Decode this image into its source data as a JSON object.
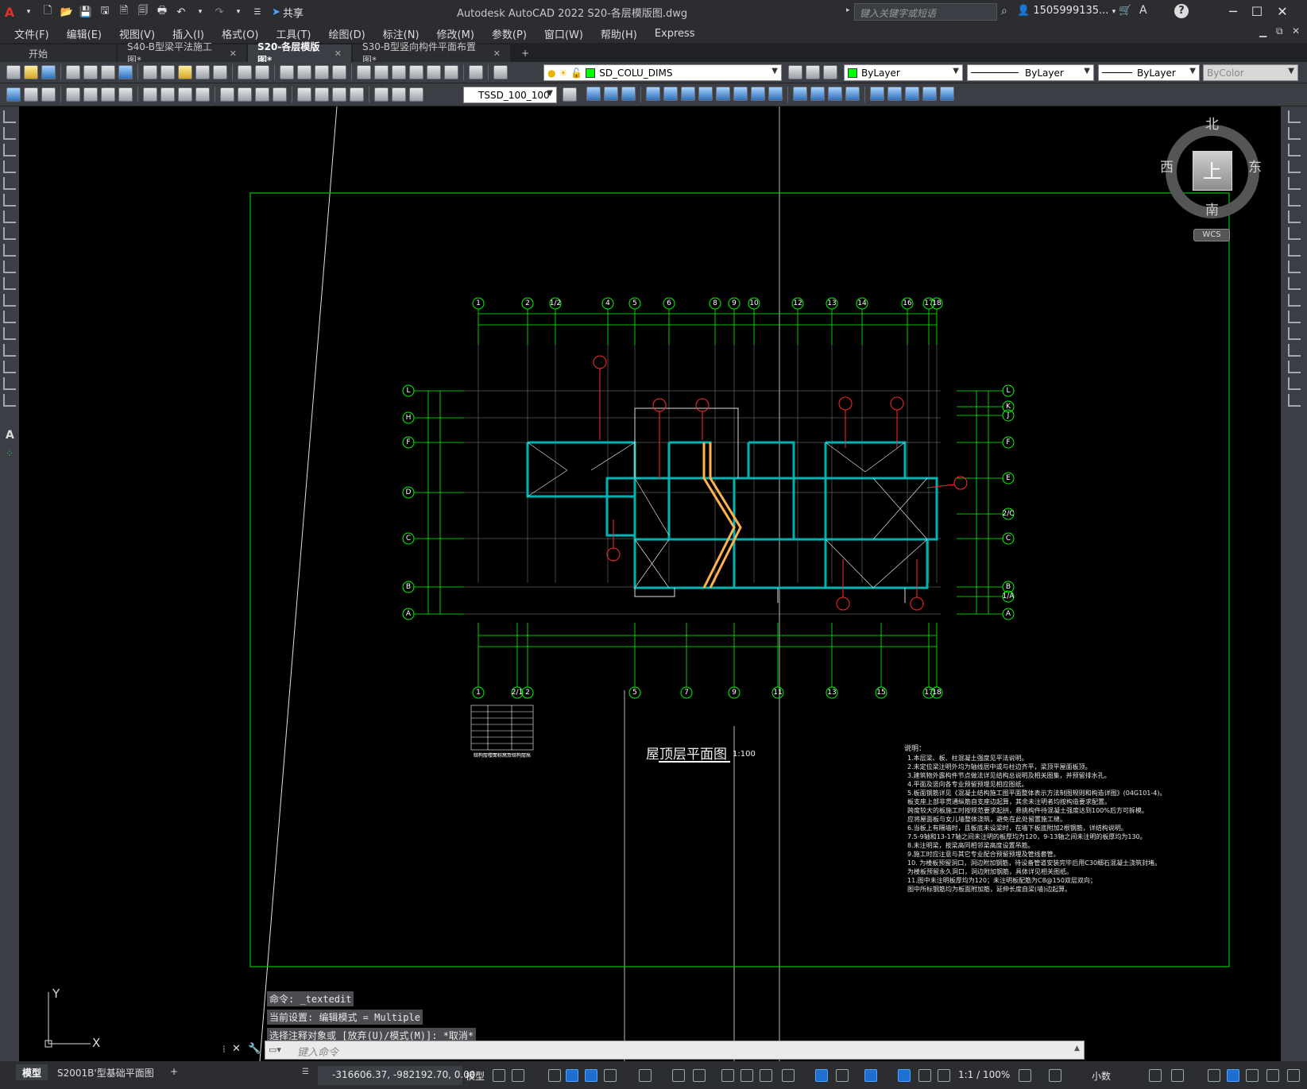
{
  "app": {
    "title": "Autodesk AutoCAD 2022    S20-各层模版图.dwg",
    "search_placeholder": "键入关键字或短语",
    "user": "1505999135...",
    "share_label": "共享"
  },
  "menu": [
    "文件(F)",
    "编辑(E)",
    "视图(V)",
    "插入(I)",
    "格式(O)",
    "工具(T)",
    "绘图(D)",
    "标注(N)",
    "修改(M)",
    "参数(P)",
    "窗口(W)",
    "帮助(H)",
    "Express"
  ],
  "tabs": [
    {
      "label": "开始",
      "active": false,
      "closable": false
    },
    {
      "label": "S40-B型梁平法施工图*",
      "active": false,
      "closable": true
    },
    {
      "label": "S20-各层模版图*",
      "active": true,
      "closable": true
    },
    {
      "label": "S30-B型竖向构件平面布置图*",
      "active": false,
      "closable": true
    }
  ],
  "toolbar": {
    "layer": "SD_COLU_DIMS",
    "color": "ByLayer",
    "linetype": "ByLayer",
    "lineweight": "ByLayer",
    "plotstyle": "ByColor",
    "annoscale": "TSSD_100_100"
  },
  "colors": {
    "grid_green": "#00ff00",
    "wall_cyan": "#00b3b3",
    "tag_red": "#ff2a2a",
    "beam_orange": "#ffb050",
    "border_green": "#00c800"
  },
  "compass": {
    "north": "北",
    "south": "南",
    "east": "东",
    "west": "西",
    "top": "上",
    "wcs": "WCS"
  },
  "drawing": {
    "top_axes": [
      "1",
      "2",
      "1/2",
      "4",
      "5",
      "6",
      "8",
      "9",
      "10",
      "12",
      "13",
      "14",
      "16",
      "17",
      "18"
    ],
    "bottom_axes": [
      "1",
      "2/1",
      "2",
      "5",
      "7",
      "9",
      "11",
      "13",
      "15",
      "17",
      "18"
    ],
    "left_axes": [
      "L",
      "H",
      "F",
      "D",
      "C",
      "B",
      "A"
    ],
    "right_axes": [
      "L",
      "K",
      "J",
      "F",
      "E",
      "2/C",
      "C",
      "B",
      "1/A",
      "A"
    ],
    "plan_title": "屋顶层平面图",
    "plan_scale": "1:100",
    "notes_title": "说明：",
    "notes": [
      "1.本层梁、板、柱混凝土强度见平法说明。",
      "2.未定位梁注明外均为轴线居中或与柱边齐平，梁顶平屋面板顶。",
      "3.建筑物外露构件节点做法详见结构总说明及相关图集，并预留排水孔。",
      "4.平面及竖向各专业预留预埋见相应图纸。",
      "5.板面钢筋详见《混凝土结构施工图平面整体表示方法制图规则和构造详图》(04G101-4)。",
      "   板支座上部非贯通纵筋自支座边起算，其余未注明者均按构造要求配置。",
      "   跨度较大的板施工时按规范要求起拱，悬挑构件待混凝土强度达到100%后方可拆模。",
      "   应将屋面板与女儿墙整体浇筑，避免在此处留置施工缝。",
      "6.当板上有隔墙时，且板底未设梁时，在墙下板底附加2根钢筋，详结构说明。",
      "7.5-9轴和13-17轴之间未注明的板厚均为120，9-13轴之间未注明的板厚均为130。",
      "8.未注明梁，按梁高同相邻梁高度设置吊筋。",
      "9.施工时应注意与其它专业配合预留预埋及管线套管。",
      "10.   为楼板预留洞口，洞边附加钢筋，待设备管道安装完毕后用C30细石混凝土浇筑封堵。",
      "      为楼板预留永久洞口，洞边附加钢筋，具体详见相关图纸。",
      "11.图中未注明板厚均为120；未注明板配筋为C8@150双层双向；",
      "   图中所标钢筋均为板面附加筋，延伸长度自梁(墙)边起算。"
    ],
    "table_caption": "结构层楼面标高及结构层高"
  },
  "command": {
    "history": [
      "命令: _textedit",
      "当前设置: 编辑模式 = Multiple",
      "选择注释对象或 [放弃(U)/模式(M)]: *取消*"
    ],
    "placeholder": "键入命令"
  },
  "status": {
    "layouts": [
      {
        "label": "模型",
        "active": true
      },
      {
        "label": "S2001B'型基础平面图",
        "active": false
      }
    ],
    "coords": "-316606.37, -982192.70, 0.00",
    "space": "模型",
    "scale": "1:1 / 100%",
    "units": "小数"
  }
}
